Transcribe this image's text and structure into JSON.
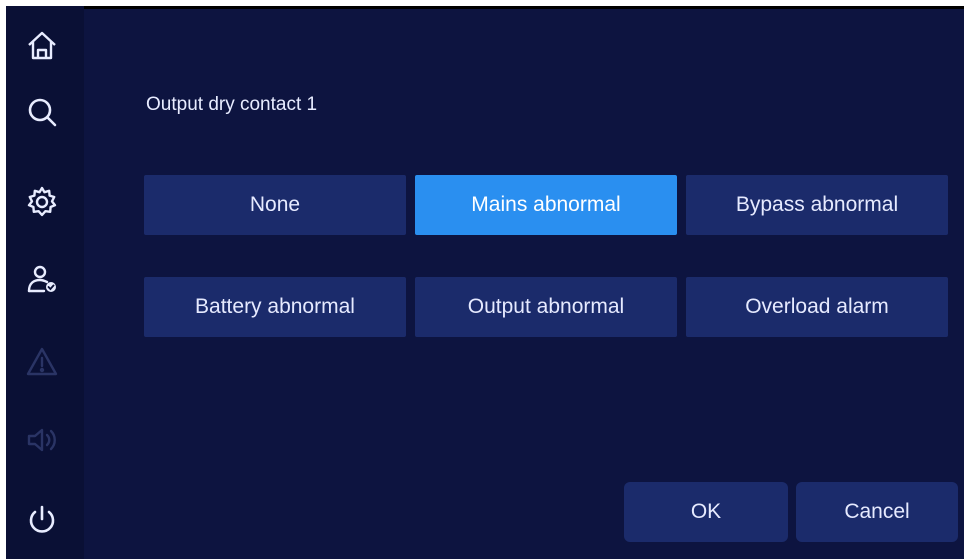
{
  "title": "Output dry contact 1",
  "options": [
    {
      "label": "None",
      "selected": false
    },
    {
      "label": "Mains abnormal",
      "selected": true
    },
    {
      "label": "Bypass abnormal",
      "selected": false
    },
    {
      "label": "Battery abnormal",
      "selected": false
    },
    {
      "label": "Output abnormal",
      "selected": false
    },
    {
      "label": "Overload alarm",
      "selected": false
    }
  ],
  "buttons": {
    "ok_label": "OK",
    "cancel_label": "Cancel"
  },
  "sidebar": {
    "items": [
      {
        "icon": "home-icon",
        "enabled": true
      },
      {
        "icon": "search-icon",
        "enabled": true
      },
      {
        "icon": "gear-icon",
        "enabled": true
      },
      {
        "icon": "user-check-icon",
        "enabled": true
      },
      {
        "icon": "warning-icon",
        "enabled": false
      },
      {
        "icon": "speaker-icon",
        "enabled": false
      },
      {
        "icon": "power-icon",
        "enabled": true
      }
    ]
  },
  "colors": {
    "background": "#0d1440",
    "sidebar": "#0a1035",
    "option": "#1b2b6b",
    "option_selected": "#2a8ff0",
    "text": "#e6eaff",
    "icon": "#e8ecff",
    "icon_disabled": "#2a3465"
  }
}
